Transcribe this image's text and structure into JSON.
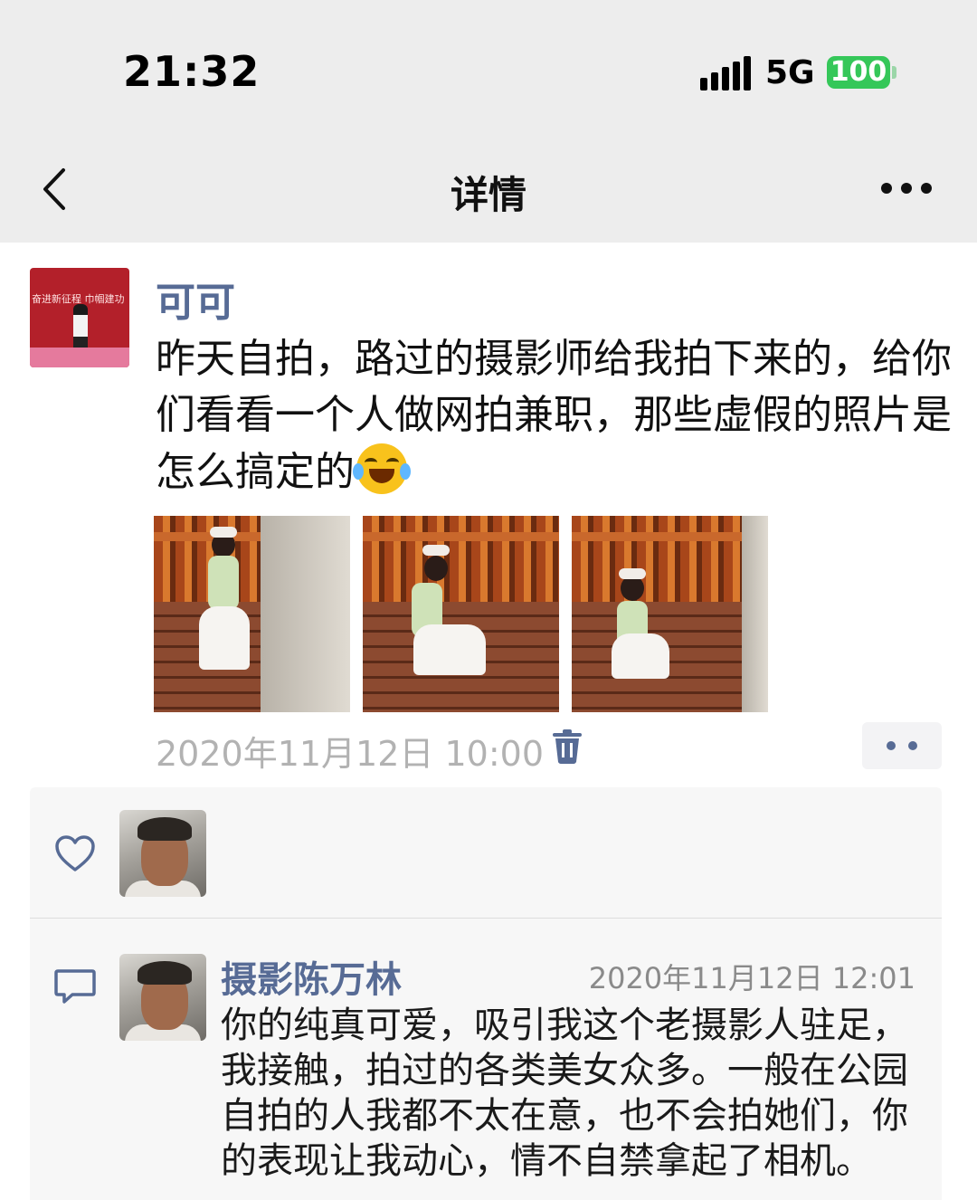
{
  "status_bar": {
    "time": "21:32",
    "network": "5G",
    "battery": "100"
  },
  "nav": {
    "title": "详情",
    "back_icon": "chevron-left-icon",
    "more_icon": "more-dots-icon"
  },
  "post": {
    "author": "可可",
    "text": "昨天自拍，路过的摄影师给我拍下来的，给你们看看一个人做网拍兼职，那些虚假的照片是怎么搞定的",
    "emoji": "tears-of-joy-emoji",
    "photo_count": 3,
    "timestamp": "2020年11月12日 10:00",
    "avatar_text": "奋进新征程 巾帼建功"
  },
  "likes": {
    "icon": "heart-icon"
  },
  "comments": [
    {
      "author": "摄影陈万林",
      "time": "2020年11月12日 12:01",
      "text": "你的纯真可爱，吸引我这个老摄影人驻足，我接触，拍过的各类美女众多。一般在公园自拍的人我都不太在意，也不会拍她们，你的表现让我动心，情不自禁拿起了相机。"
    }
  ],
  "colors": {
    "link_blue": "#576b95",
    "battery_green": "#35c759",
    "header_gray": "#ededed",
    "panel_gray": "#f7f7f7"
  }
}
